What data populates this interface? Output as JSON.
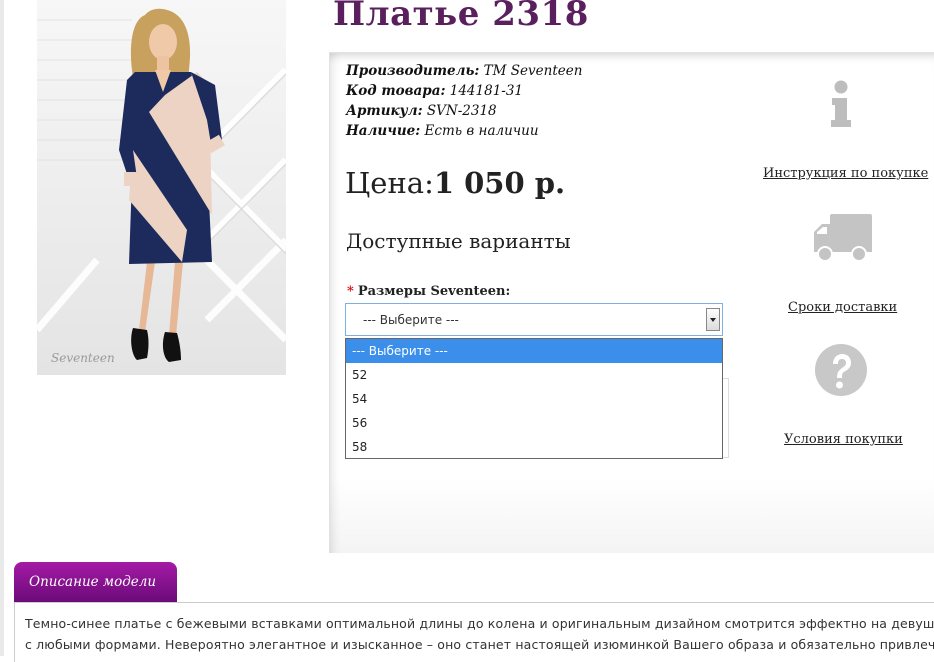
{
  "product": {
    "title": "Платье 2318"
  },
  "details": {
    "manufacturer_label": "Производитель:",
    "manufacturer_value": "ТМ Seventeen",
    "code_label": "Код товара:",
    "code_value": "144181-31",
    "article_label": "Артикул:",
    "article_value": "SVN-2318",
    "stock_label": "Наличие:",
    "stock_value": "Есть в наличии"
  },
  "price": {
    "label": "Цена:",
    "value": "1 050 р."
  },
  "variants": {
    "heading": "Доступные варианты",
    "size_label": "Размеры Seventeen:",
    "required_mark": "*",
    "select_value": "--- Выберите ---",
    "options": [
      "--- Выберите ---",
      "52",
      "54",
      "56",
      "58"
    ],
    "selected_index": 0
  },
  "sidebar": {
    "instruction_label": "Инструкция по покупке",
    "delivery_label": "Сроки доставки",
    "conditions_label": "Условия покупки",
    "instruction_icon": "info-icon",
    "delivery_icon": "truck-icon",
    "conditions_icon": "question-icon"
  },
  "description": {
    "tab_label": "Описание модели",
    "line1": "Темно-синее платье с бежевыми вставками оптимальной длины до колена и оригинальным дизайном смотрится эффектно на девушке",
    "line2": "с любыми формами. Невероятно элегантное и изысканное – оно станет настоящей изюминкой Вашего образа и обязательно привлечет"
  },
  "colors": {
    "title": "#5a1f5d",
    "tab": "#8e169a",
    "dropdown_highlight": "#3b8fea",
    "required": "#dd1111"
  }
}
